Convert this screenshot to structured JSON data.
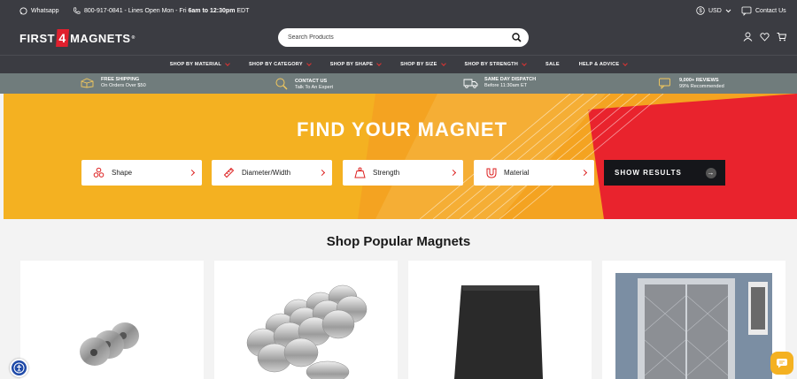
{
  "topbar": {
    "whatsapp_label": "Whatsapp",
    "phone_number": "800-917-0841",
    "phone_sep": " - Lines Open Mon - Fri ",
    "phone_hours": "6am to 12:30pm",
    "phone_tz": " EDT",
    "currency_label": "USD",
    "contact_label": "Contact Us"
  },
  "header": {
    "logo_first": "FIRST",
    "logo_four": "4",
    "logo_magnets": "MAGNETS",
    "logo_tm": "®",
    "search_placeholder": "Search Products"
  },
  "nav": {
    "items": [
      {
        "label": "SHOP BY MATERIAL"
      },
      {
        "label": "SHOP BY CATEGORY"
      },
      {
        "label": "SHOP BY SHAPE"
      },
      {
        "label": "SHOP BY SIZE"
      },
      {
        "label": "SHOP BY STRENGTH"
      },
      {
        "label": "SALE"
      },
      {
        "label": "HELP & ADVICE"
      }
    ]
  },
  "usps": [
    {
      "title": "FREE SHIPPING",
      "sub": "On Orders Over $50",
      "icon": "box-icon"
    },
    {
      "title": "CONTACT US",
      "sub": "Talk To An Expert",
      "icon": "expert-icon"
    },
    {
      "title": "SAME DAY DISPATCH",
      "sub": "Before 11:30am ET",
      "icon": "truck-icon"
    },
    {
      "title": "9,000+ REVIEWS",
      "sub": "99% Recommended",
      "icon": "reviews-icon"
    }
  ],
  "hero": {
    "title": "FIND YOUR MAGNET",
    "filters": [
      {
        "label": "Shape",
        "icon": "shapes-icon"
      },
      {
        "label": "Diameter/Width",
        "icon": "ruler-icon"
      },
      {
        "label": "Strength",
        "icon": "weight-icon"
      },
      {
        "label": "Material",
        "icon": "magnet-icon"
      }
    ],
    "show_results": "SHOW RESULTS"
  },
  "popular": {
    "title": "Shop Popular Magnets"
  },
  "colors": {
    "dark": "#3b3c42",
    "accent_red": "#e0202e",
    "hero_yellow": "#f4b121",
    "usp_bar": "#707c7c"
  }
}
